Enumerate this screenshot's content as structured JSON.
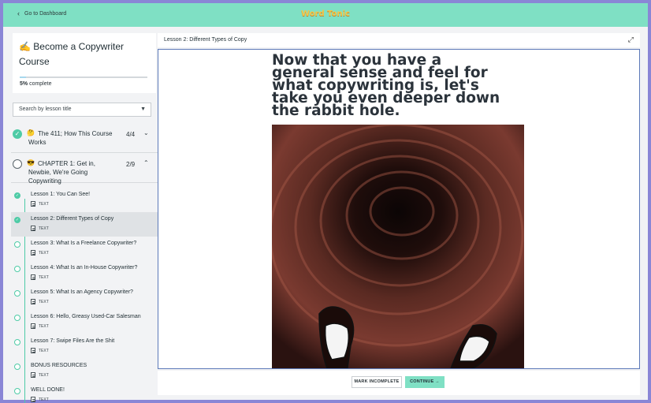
{
  "topbar": {
    "back_label": "Go to Dashboard",
    "logo_text": "Word Tonic"
  },
  "course": {
    "icon": "✍️",
    "title": "Become a Copywriter Course",
    "progress_percent": 5,
    "progress_bold": "5%",
    "progress_rest": " complete"
  },
  "search": {
    "placeholder": "Search by lesson title"
  },
  "sections": [
    {
      "emoji": "🤔",
      "title": "The 411; How This Course Works",
      "count": "4/4",
      "complete": true,
      "expanded": false
    },
    {
      "emoji": "😎",
      "title": "CHAPTER 1: Get in, Newbie, We're Going Copywriting",
      "count": "2/9",
      "complete": false,
      "expanded": true
    }
  ],
  "lessons": [
    {
      "title": "Lesson 1: You Can See!",
      "type": "TEXT",
      "done": true
    },
    {
      "title": "Lesson 2: Different Types of Copy",
      "type": "TEXT",
      "done": true,
      "active": true
    },
    {
      "title": "Lesson 3: What Is a Freelance Copywriter?",
      "type": "TEXT",
      "done": false
    },
    {
      "title": "Lesson 4: What Is an In-House Copywriter?",
      "type": "TEXT",
      "done": false
    },
    {
      "title": "Lesson 5: What Is an Agency Copywriter?",
      "type": "TEXT",
      "done": false
    },
    {
      "title": "Lesson 6: Hello, Greasy Used-Car Salesman",
      "type": "TEXT",
      "done": false
    },
    {
      "title": "Lesson 7: Swipe Files Are the Shit",
      "type": "TEXT",
      "done": false
    },
    {
      "title": "BONUS RESOURCES",
      "type": "TEXT",
      "done": false
    },
    {
      "title": "WELL DONE!",
      "type": "TEXT",
      "done": false
    }
  ],
  "main": {
    "lesson_title": "Lesson 2: Different Types of Copy",
    "headline": "Now that you have a general sense and feel for what copywriting is, let's take you even deeper down the rabbit hole."
  },
  "footer": {
    "mark_incomplete": "MARK INCOMPLETE",
    "continue": "CONTINUE →"
  },
  "colors": {
    "accent": "#7fe0c4",
    "check": "#4ecba6",
    "frame": "#5c79b8",
    "background": "#8a86d6"
  },
  "icons": {
    "back": "chevron-left-icon",
    "expand": "expand-icon",
    "check": "check-circle-icon",
    "doc": "document-icon"
  }
}
